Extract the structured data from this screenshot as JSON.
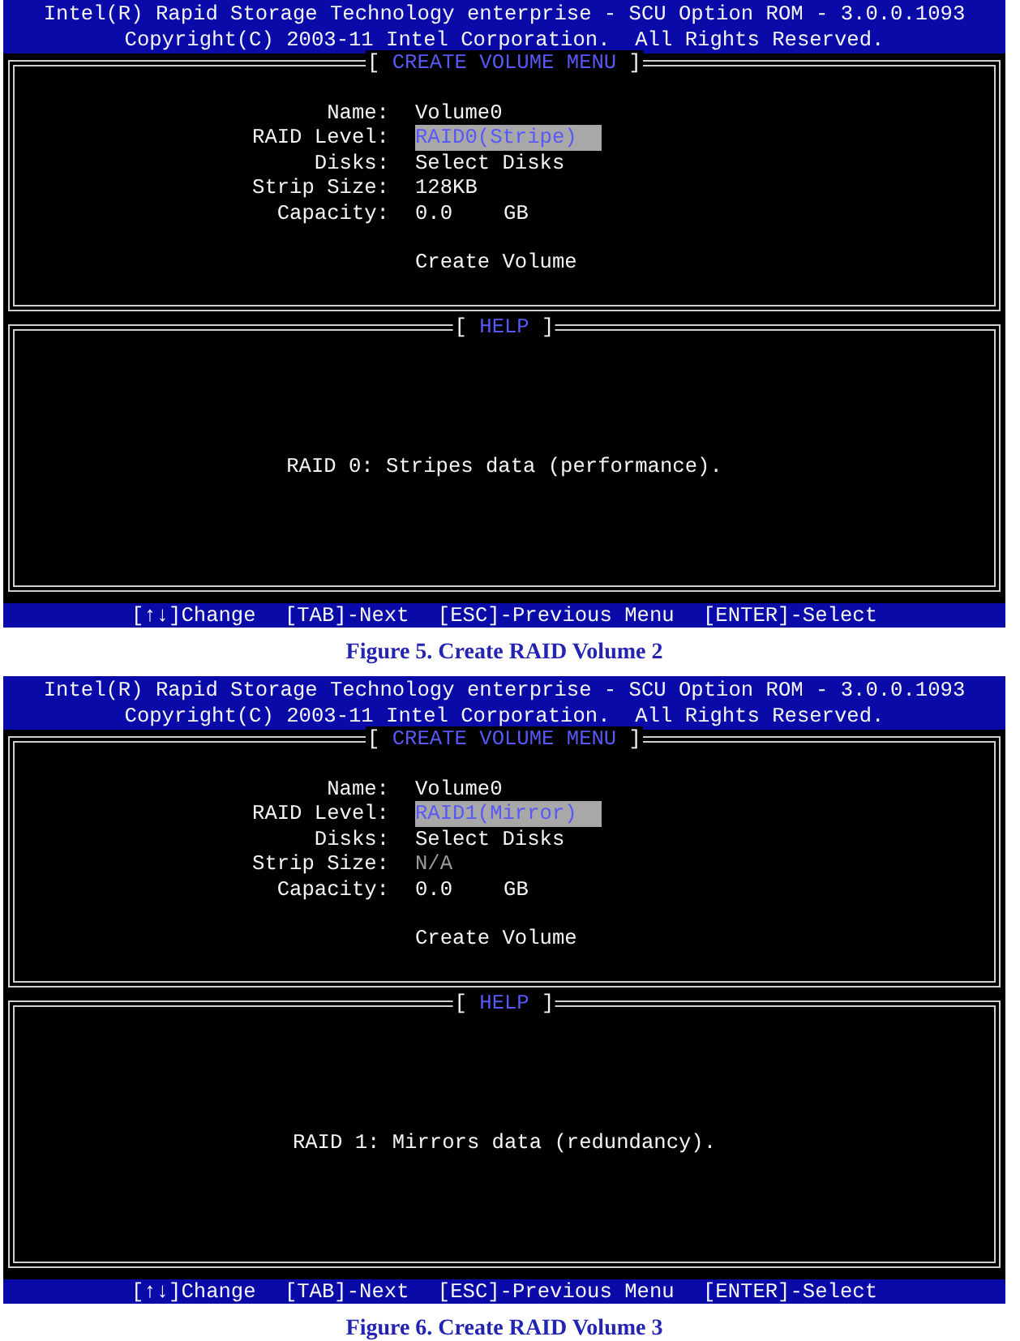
{
  "figures": [
    {
      "screen": {
        "header": {
          "title": "Intel(R) Rapid Storage Technology enterprise - SCU Option ROM - 3.0.0.1093",
          "copyright": "Copyright(C) 2003-11 Intel Corporation.  All Rights Reserved."
        },
        "menu": {
          "title": {
            "open": "[",
            "text": "CREATE VOLUME MENU",
            "close": "]"
          },
          "fields": [
            {
              "label": "Name:",
              "value": "Volume0",
              "selected": false,
              "disabled": false
            },
            {
              "label": "RAID Level:",
              "value": "RAID0(Stripe)",
              "selected": true,
              "disabled": false
            },
            {
              "label": "Disks:",
              "value": "Select Disks",
              "selected": false,
              "disabled": false
            },
            {
              "label": "Strip Size:",
              "value": "128KB",
              "selected": false,
              "disabled": false
            },
            {
              "label": "Capacity:",
              "value": "0.0",
              "unit": "GB",
              "selected": false,
              "disabled": false
            }
          ],
          "action": "Create Volume"
        },
        "help": {
          "title": {
            "open": "[",
            "text": "HELP",
            "close": "]"
          },
          "text": "RAID 0: Stripes data (performance)."
        },
        "key_hints": [
          "[↑↓]Change",
          "[TAB]-Next",
          "[ESC]-Previous Menu",
          "[ENTER]-Select"
        ]
      },
      "caption": "Figure 5. Create RAID Volume 2"
    },
    {
      "screen": {
        "header": {
          "title": "Intel(R) Rapid Storage Technology enterprise - SCU Option ROM - 3.0.0.1093",
          "copyright": "Copyright(C) 2003-11 Intel Corporation.  All Rights Reserved."
        },
        "menu": {
          "title": {
            "open": "[",
            "text": "CREATE VOLUME MENU",
            "close": "]"
          },
          "fields": [
            {
              "label": "Name:",
              "value": "Volume0",
              "selected": false,
              "disabled": false
            },
            {
              "label": "RAID Level:",
              "value": "RAID1(Mirror)",
              "selected": true,
              "disabled": false
            },
            {
              "label": "Disks:",
              "value": "Select Disks",
              "selected": false,
              "disabled": false
            },
            {
              "label": "Strip Size:",
              "value": "N/A",
              "selected": false,
              "disabled": true
            },
            {
              "label": "Capacity:",
              "value": "0.0",
              "unit": "GB",
              "selected": false,
              "disabled": false
            }
          ],
          "action": "Create Volume"
        },
        "help": {
          "title": {
            "open": "[",
            "text": "HELP",
            "close": "]"
          },
          "text": "RAID 1: Mirrors data (redundancy)."
        },
        "key_hints": [
          "[↑↓]Change",
          "[TAB]-Next",
          "[ESC]-Previous Menu",
          "[ENTER]-Select"
        ]
      },
      "caption": "Figure 6. Create RAID Volume 3"
    }
  ]
}
